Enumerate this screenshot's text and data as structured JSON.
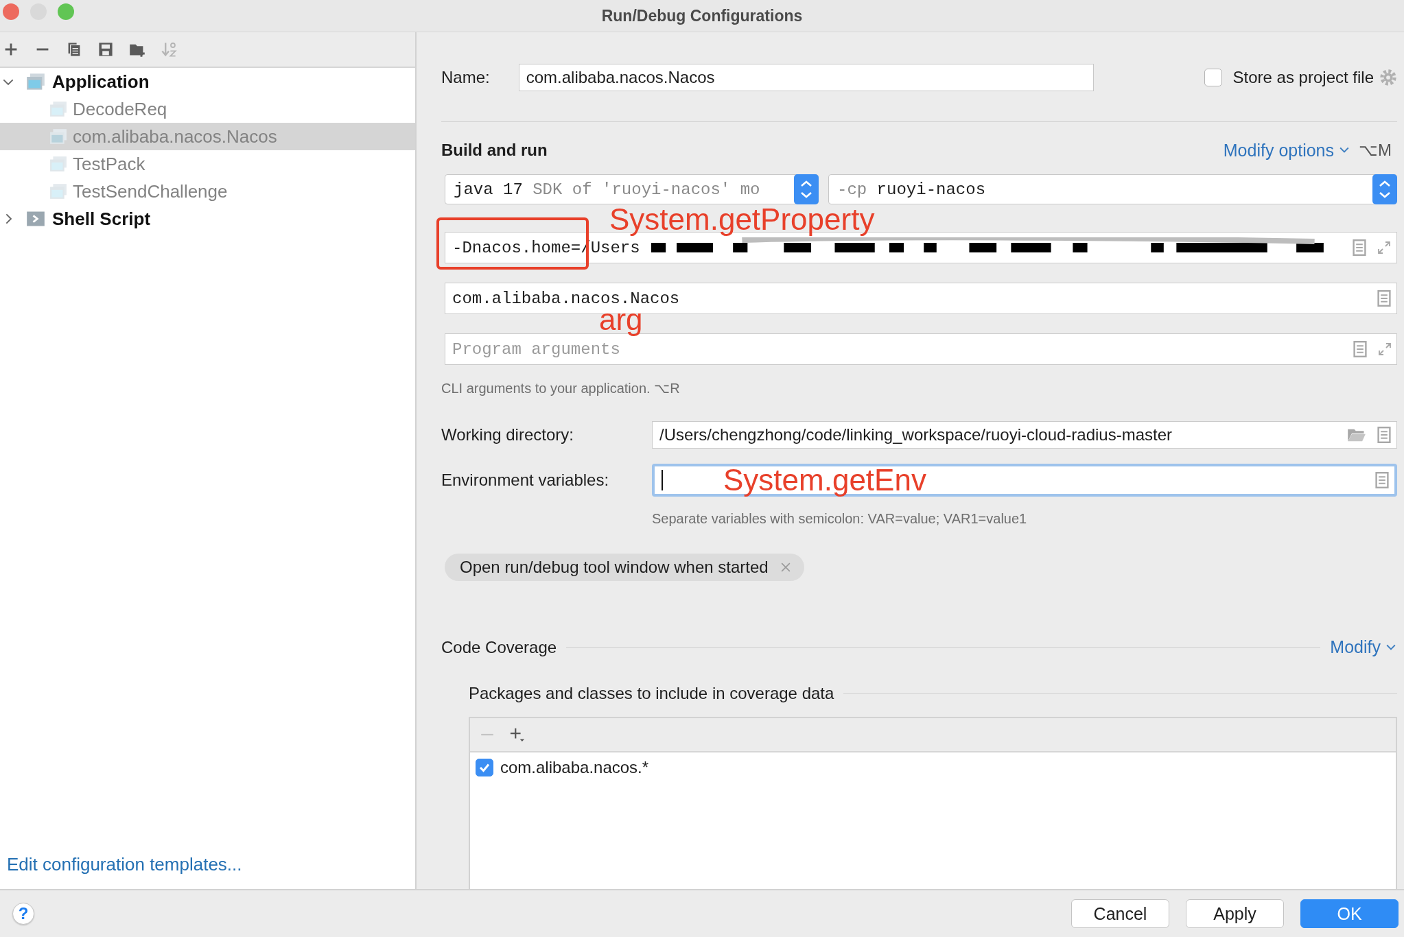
{
  "window": {
    "title": "Run/Debug Configurations",
    "controls": [
      {
        "color": "#ed6a5e"
      },
      {
        "color": "#d9d9d9"
      },
      {
        "color": "#61c554"
      }
    ]
  },
  "tree": [
    {
      "label": "Application",
      "expanded": true,
      "children": [
        {
          "label": "DecodeReq",
          "selected": false
        },
        {
          "label": "com.alibaba.nacos.Nacos",
          "selected": true
        },
        {
          "label": "TestPack",
          "selected": false
        },
        {
          "label": "TestSendChallenge",
          "selected": false
        }
      ]
    },
    {
      "label": "Shell Script",
      "expanded": false
    }
  ],
  "edit_templates_link": "Edit configuration templates...",
  "name": {
    "label": "Name:",
    "value": "com.alibaba.nacos.Nacos"
  },
  "store_as_project_file": {
    "label": "Store as project file",
    "checked": false
  },
  "build_and_run": {
    "title": "Build and run",
    "modify_options": "Modify options",
    "shortcut": "⌥M"
  },
  "jre": {
    "value": "java 17",
    "hint": "SDK of 'ruoyi-nacos' mo"
  },
  "classpath": {
    "prefix": "-cp",
    "value": "ruoyi-nacos"
  },
  "vm_options": {
    "value": "-Dnacos.home=/Users",
    "highlighted": true,
    "annotation": "System.getProperty"
  },
  "main_class": {
    "value": "com.alibaba.nacos.Nacos"
  },
  "program_arguments": {
    "placeholder": "Program arguments",
    "annotation": "arg"
  },
  "cli_hint": "CLI arguments to your application. ⌥R",
  "working_directory": {
    "label": "Working directory:",
    "value": "/Users/chengzhong/code/linking_workspace/ruoyi-cloud-radius-master"
  },
  "environment_variables": {
    "label": "Environment variables:",
    "focused": true,
    "annotation": "System.getEnv"
  },
  "env_hint": "Separate variables with semicolon: VAR=value; VAR1=value1",
  "chip": {
    "label": "Open run/debug tool window when started"
  },
  "code_coverage": {
    "title": "Code Coverage",
    "modify": "Modify",
    "packages_title": "Packages and classes to include in coverage data",
    "patterns": [
      {
        "label": "com.alibaba.nacos.*",
        "checked": true
      }
    ]
  },
  "help": "?",
  "buttons": [
    {
      "label": "Cancel",
      "kind": "normal"
    },
    {
      "label": "Apply",
      "kind": "normal"
    },
    {
      "label": "OK",
      "kind": "primary"
    }
  ]
}
